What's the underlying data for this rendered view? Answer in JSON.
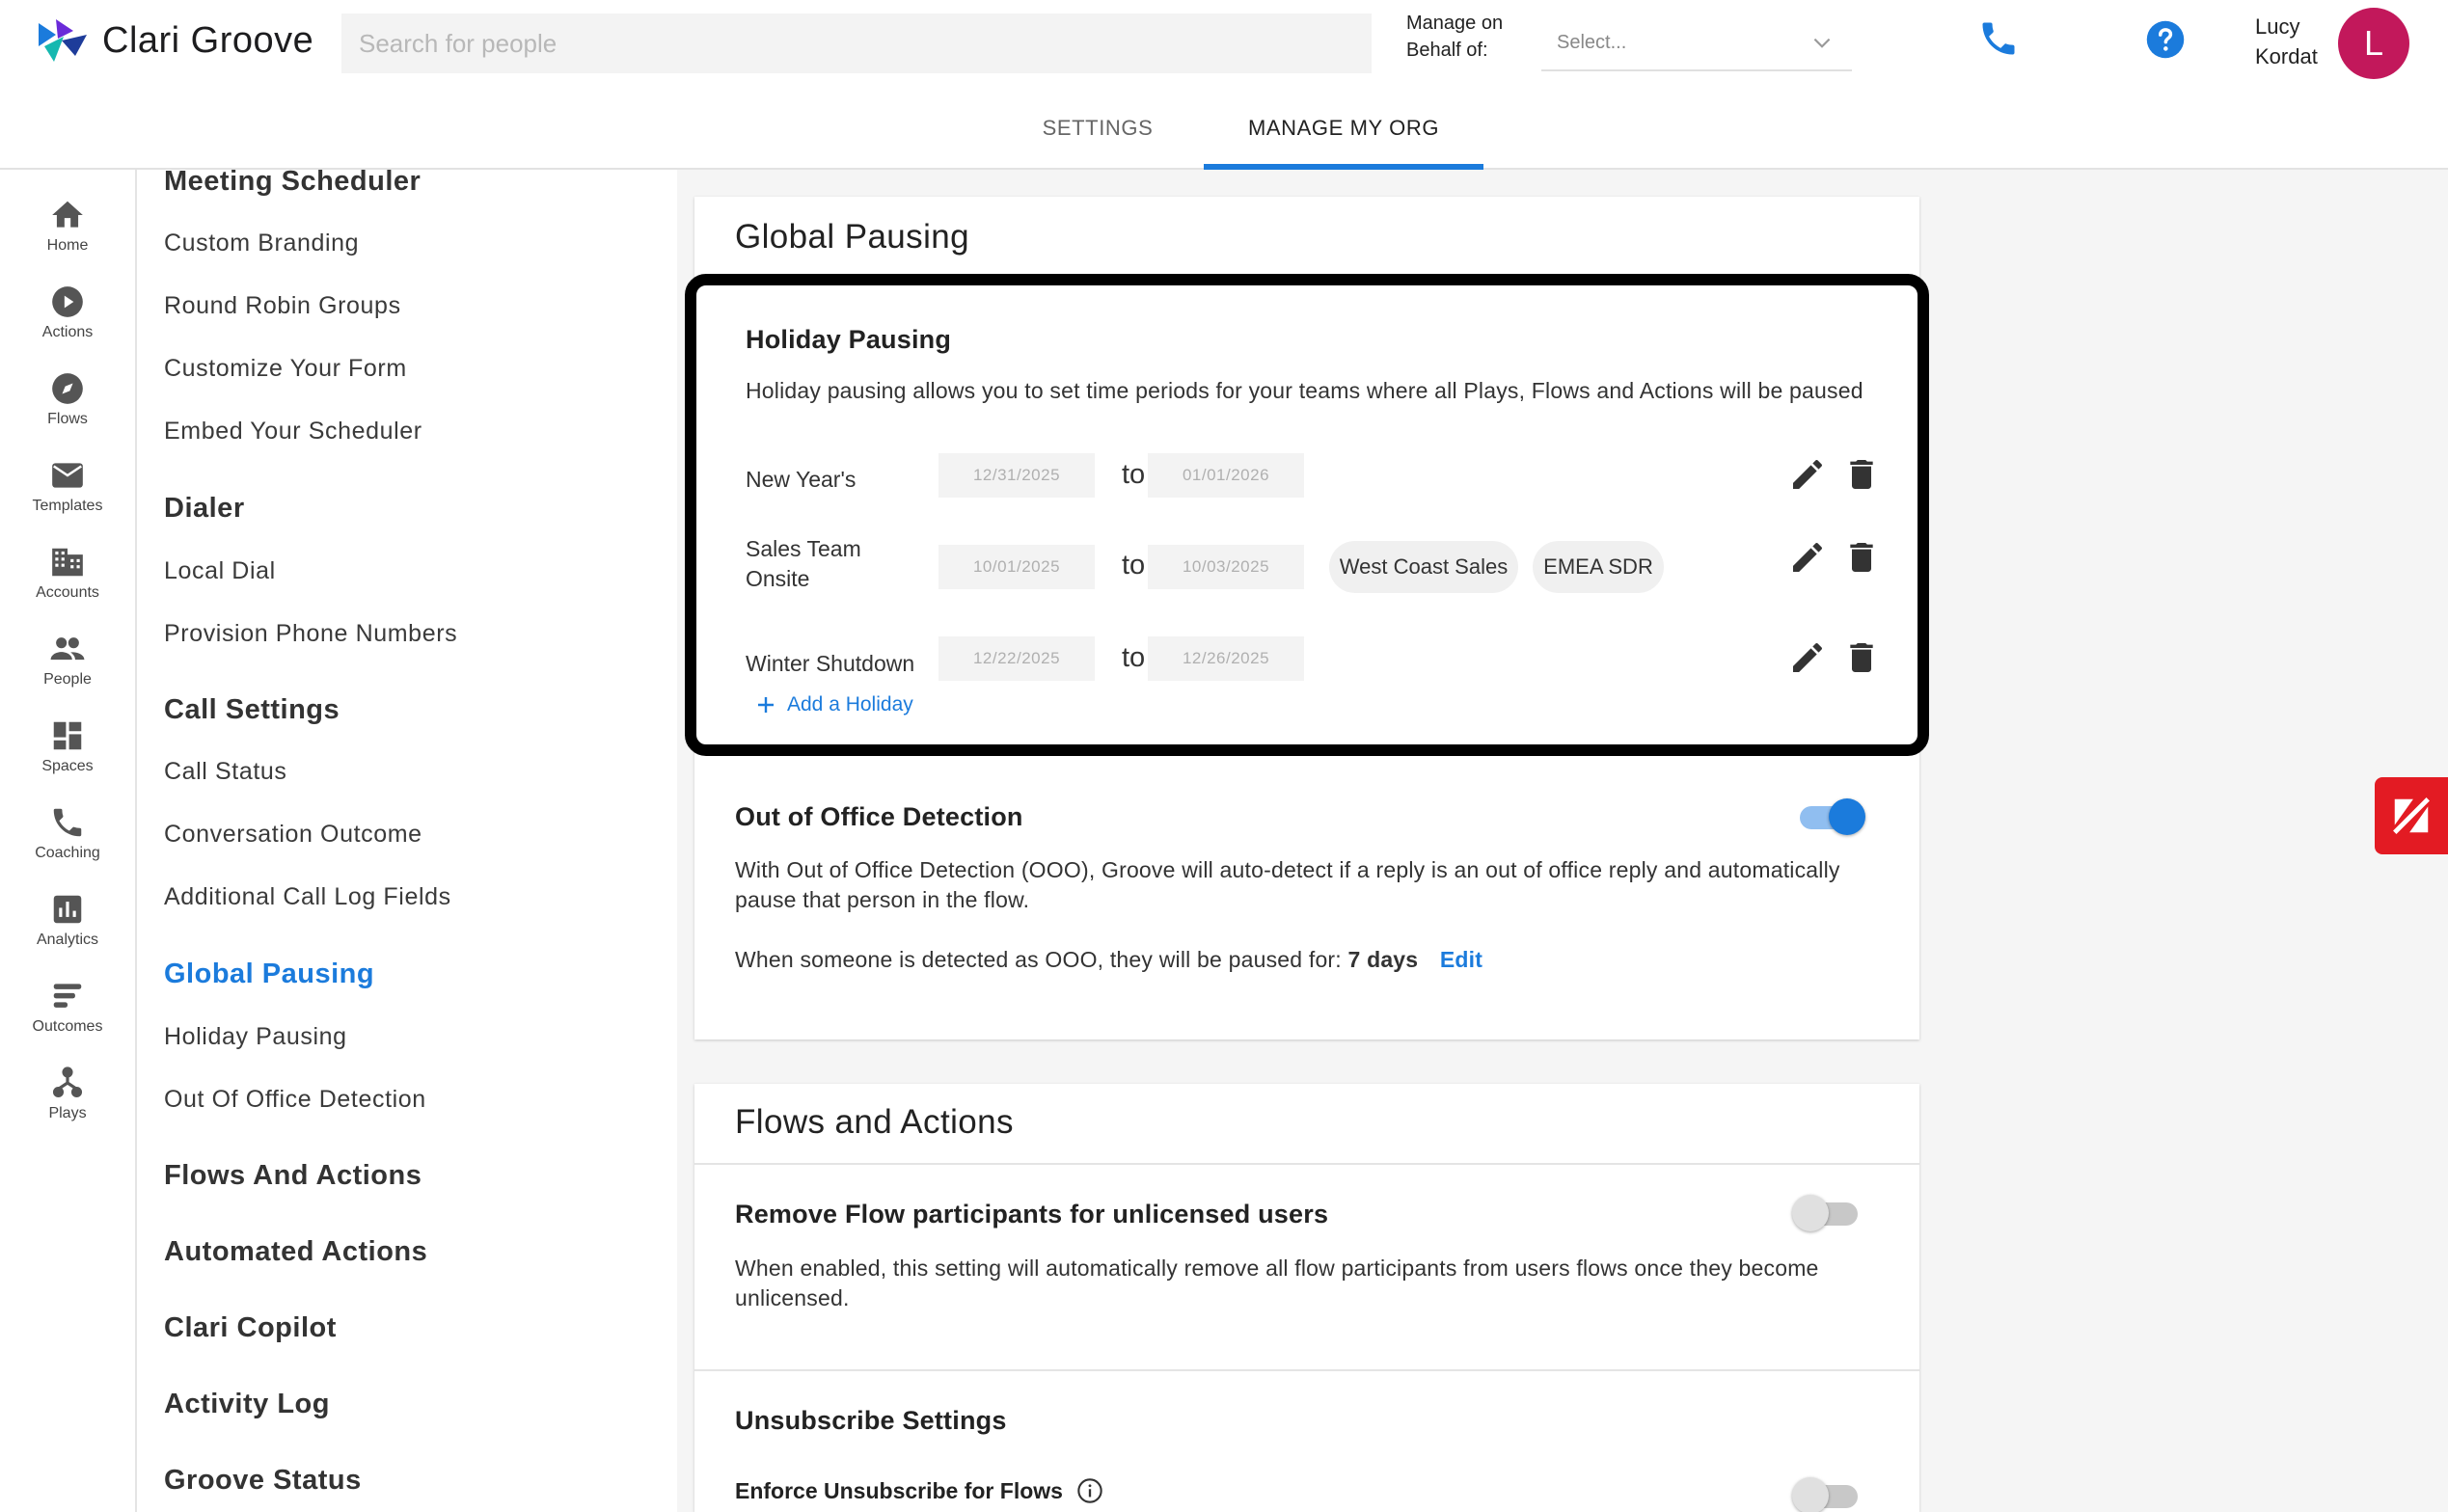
{
  "app": {
    "name": "Clari Groove"
  },
  "header": {
    "search_placeholder": "Search for people",
    "behalf_label": "Manage on Behalf of:",
    "behalf_select": "Select...",
    "user_first": "Lucy",
    "user_last": "Kordat",
    "avatar_initial": "L"
  },
  "tabs": {
    "settings": "SETTINGS",
    "manage_org": "MANAGE MY ORG",
    "active": "manage_org"
  },
  "rail": {
    "home": "Home",
    "actions": "Actions",
    "flows": "Flows",
    "templates": "Templates",
    "accounts": "Accounts",
    "people": "People",
    "spaces": "Spaces",
    "coaching": "Coaching",
    "analytics": "Analytics",
    "outcomes": "Outcomes",
    "plays": "Plays"
  },
  "subnav": {
    "meeting_scheduler": "Meeting Scheduler",
    "custom_branding": "Custom Branding",
    "round_robin_groups": "Round Robin Groups",
    "customize_form": "Customize Your Form",
    "embed_scheduler": "Embed Your Scheduler",
    "dialer": "Dialer",
    "local_dial": "Local Dial",
    "provision_numbers": "Provision Phone Numbers",
    "call_settings": "Call Settings",
    "call_status": "Call Status",
    "conversation_outcome": "Conversation Outcome",
    "additional_call_log": "Additional Call Log Fields",
    "global_pausing": "Global Pausing",
    "holiday_pausing": "Holiday Pausing",
    "ooo_detection": "Out Of Office Detection",
    "flows_actions": "Flows And Actions",
    "automated_actions": "Automated Actions",
    "clari_copilot": "Clari Copilot",
    "activity_log": "Activity Log",
    "groove_status": "Groove Status"
  },
  "global_pausing": {
    "title": "Global Pausing",
    "holiday": {
      "title": "Holiday Pausing",
      "description": "Holiday pausing allows you to set time periods for your teams where all Plays, Flows and Actions will be paused",
      "to_label": "to",
      "rows": [
        {
          "name": "New Year's",
          "start": "12/31/2025",
          "end": "01/01/2026",
          "teams": []
        },
        {
          "name": "Sales Team Onsite",
          "start": "10/01/2025",
          "end": "10/03/2025",
          "teams": [
            "West Coast Sales",
            "EMEA SDR"
          ]
        },
        {
          "name": "Winter Shutdown",
          "start": "12/22/2025",
          "end": "12/26/2025",
          "teams": []
        }
      ],
      "add_label": "Add a Holiday"
    },
    "ooo": {
      "title": "Out of Office Detection",
      "enabled": true,
      "description": "With Out of Office Detection (OOO), Groove will auto-detect if a reply is an out of office reply and automatically pause that person in the flow.",
      "paused_for_text": "When someone is detected as OOO, they will be paused for:",
      "paused_for_value": "7 days",
      "edit_label": "Edit"
    }
  },
  "flows_actions": {
    "title": "Flows and Actions",
    "remove_participants": {
      "title": "Remove Flow participants for unlicensed users",
      "enabled": false,
      "description": "When enabled, this setting will automatically remove all flow participants from users flows once they become unlicensed."
    },
    "unsubscribe": {
      "title": "Unsubscribe Settings",
      "enforce_label": "Enforce Unsubscribe for Flows",
      "enabled": false
    }
  },
  "colors": {
    "accent": "#1b7bdc",
    "avatar": "#c2185b",
    "zendesk": "#e31b23"
  }
}
